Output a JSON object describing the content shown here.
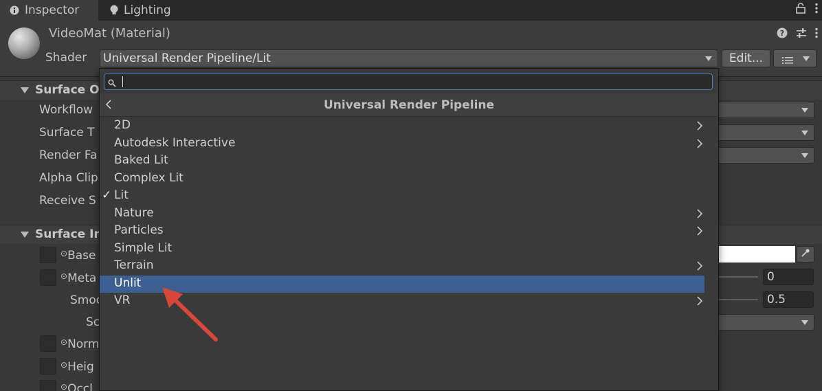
{
  "tabs": [
    {
      "label": "Inspector",
      "icon": "info-icon"
    },
    {
      "label": "Lighting",
      "icon": "lightbulb-icon"
    }
  ],
  "material": {
    "title": "VideoMat (Material)",
    "shader_label": "Shader",
    "shader_value": "Universal Render Pipeline/Lit",
    "edit_label": "Edit..."
  },
  "sections": {
    "surface_options": {
      "title": "Surface O",
      "rows": [
        "Workflow",
        "Surface T",
        "Render Fa",
        "Alpha Clip",
        "Receive S"
      ]
    },
    "surface_inputs": {
      "title": "Surface In",
      "rows": [
        "Base",
        "Meta",
        "Smoo",
        "Sc",
        "Norm",
        "Heig",
        "Occl"
      ],
      "metallic_value": "0",
      "smoothness_value": "0.5",
      "base_color": "#ffffff"
    }
  },
  "popup": {
    "search_value": "",
    "header": "Universal Render Pipeline",
    "items": [
      {
        "label": "2D",
        "submenu": true,
        "checked": false,
        "selected": false
      },
      {
        "label": "Autodesk Interactive",
        "submenu": true,
        "checked": false,
        "selected": false
      },
      {
        "label": "Baked Lit",
        "submenu": false,
        "checked": false,
        "selected": false
      },
      {
        "label": "Complex Lit",
        "submenu": false,
        "checked": false,
        "selected": false
      },
      {
        "label": "Lit",
        "submenu": false,
        "checked": true,
        "selected": false
      },
      {
        "label": "Nature",
        "submenu": true,
        "checked": false,
        "selected": false
      },
      {
        "label": "Particles",
        "submenu": true,
        "checked": false,
        "selected": false
      },
      {
        "label": "Simple Lit",
        "submenu": false,
        "checked": false,
        "selected": false
      },
      {
        "label": "Terrain",
        "submenu": true,
        "checked": false,
        "selected": false
      },
      {
        "label": "Unlit",
        "submenu": false,
        "checked": false,
        "selected": true
      },
      {
        "label": "VR",
        "submenu": true,
        "checked": false,
        "selected": false
      }
    ],
    "check_glyph": "✓"
  },
  "colors": {
    "selected_bg": "#3d5f91",
    "annotation_arrow": "#d9473a",
    "search_focus": "#4d7fbf"
  }
}
